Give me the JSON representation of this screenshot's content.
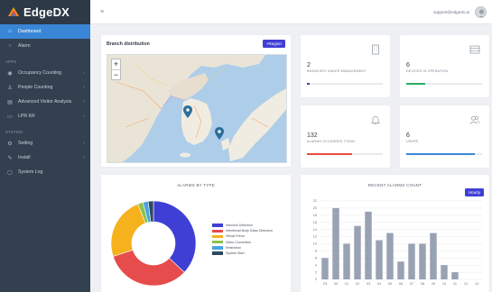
{
  "app": {
    "brand": "EdgeDX"
  },
  "topbar": {
    "user_email": "support@edgedx.ai"
  },
  "sidebar": {
    "items": [
      {
        "label": "Dashboard",
        "icon": "home-icon",
        "active": true
      },
      {
        "label": "Alarm",
        "icon": "circle-icon"
      }
    ],
    "apps_label": "APPS",
    "apps": [
      {
        "label": "Occupancy Counting",
        "icon": "user-icon"
      },
      {
        "label": "People Counting",
        "icon": "person-icon"
      },
      {
        "label": "Advanced Visitor Analysis",
        "icon": "chart-icon"
      },
      {
        "label": "LPR KR",
        "icon": "car-icon"
      }
    ],
    "system_label": "SYSTEM",
    "system": [
      {
        "label": "Setting",
        "icon": "gear-icon"
      },
      {
        "label": "Install",
        "icon": "wrench-icon"
      },
      {
        "label": "System Log",
        "icon": "document-icon"
      }
    ]
  },
  "map": {
    "title": "Branch distribution",
    "button": "+Region",
    "zoom_in": "+",
    "zoom_out": "−"
  },
  "stats": [
    {
      "value": "2",
      "label": "BRANCHES UNDER MANAGEMENT",
      "icon": "building-icon",
      "color": "#3f4aa6",
      "fill": 0.03
    },
    {
      "value": "6",
      "label": "DEVICES IN OPERATION",
      "icon": "list-icon",
      "color": "#27ae60",
      "fill": 0.25
    },
    {
      "value": "132",
      "label": "ALARMS OCCURRED TODAY",
      "icon": "bell-icon",
      "color": "#e74c3c",
      "fill": 0.6
    },
    {
      "value": "6",
      "label": "USERS",
      "icon": "users-icon",
      "color": "#3a86d6",
      "fill": 0.9
    }
  ],
  "alarms_by_type": {
    "title": "ALARMS BY TYPE"
  },
  "recent_alarms": {
    "title": "RECENT ALARMS COUNT",
    "button": "Hourly"
  },
  "chart_data": [
    {
      "type": "pie",
      "title": "ALARMS BY TYPE",
      "donut": true,
      "legend_position": "right",
      "categories": [
        "Intrusion Detection",
        "Intentional Body Glass Detection",
        "Virtual Fence",
        "Video Connection",
        "Restriction",
        "System Start"
      ],
      "values": [
        37,
        33,
        24,
        2,
        2,
        2
      ],
      "colors": [
        "#3f3fd6",
        "#e74c4c",
        "#f5b21c",
        "#8bc34a",
        "#4aa3e0",
        "#2e4a5e"
      ]
    },
    {
      "type": "bar",
      "title": "RECENT ALARMS COUNT",
      "categories": [
        "23",
        "00",
        "01",
        "02",
        "03",
        "04",
        "05",
        "06",
        "07",
        "08",
        "09",
        "10",
        "11",
        "12",
        "13"
      ],
      "values": [
        6,
        20,
        10,
        15,
        19,
        11,
        13,
        5,
        10,
        10,
        13,
        4,
        2,
        0,
        0
      ],
      "ylim": [
        0,
        22
      ],
      "yticks": [
        0,
        2,
        4,
        6,
        8,
        10,
        12,
        14,
        16,
        18,
        20,
        22
      ],
      "color": "#98a2b3",
      "grid": true
    }
  ]
}
